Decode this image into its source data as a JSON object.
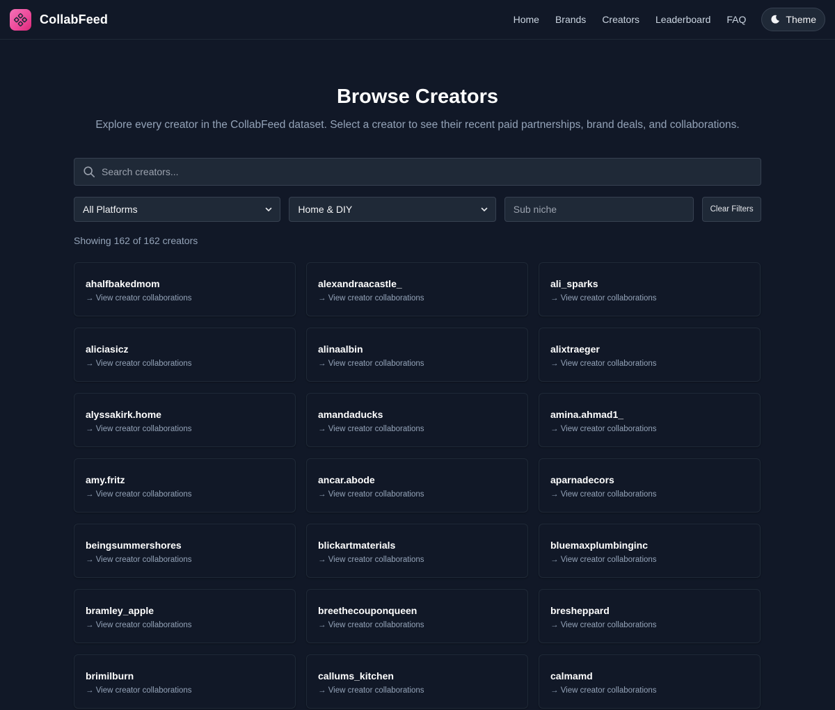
{
  "header": {
    "brand": "CollabFeed",
    "nav": [
      "Home",
      "Brands",
      "Creators",
      "Leaderboard",
      "FAQ"
    ],
    "theme_label": "Theme"
  },
  "main": {
    "title": "Browse Creators",
    "subtitle": "Explore every creator in the CollabFeed dataset. Select a creator to see their recent paid partnerships, brand deals, and collaborations.",
    "search_placeholder": "Search creators...",
    "platform_selected": "All Platforms",
    "niche_selected": "Home & DIY",
    "subniche_placeholder": "Sub niche",
    "clear_label": "Clear Filters",
    "count_text": "Showing 162 of 162 creators",
    "card_link_text": "→ View creator collaborations",
    "creators": [
      "ahalfbakedmom",
      "alexandraacastle_",
      "ali_sparks",
      "aliciasicz",
      "alinaalbin",
      "alixtraeger",
      "alyssakirk.home",
      "amandaducks",
      "amina.ahmad1_",
      "amy.fritz",
      "ancar.abode",
      "aparnadecors",
      "beingsummershores",
      "blickartmaterials",
      "bluemaxplumbinginc",
      "bramley_apple",
      "breethecouponqueen",
      "bresheppard",
      "brimilburn",
      "callums_kitchen",
      "calmamd"
    ]
  },
  "colors": {
    "background": "#111827",
    "accent": "#ec4899"
  }
}
